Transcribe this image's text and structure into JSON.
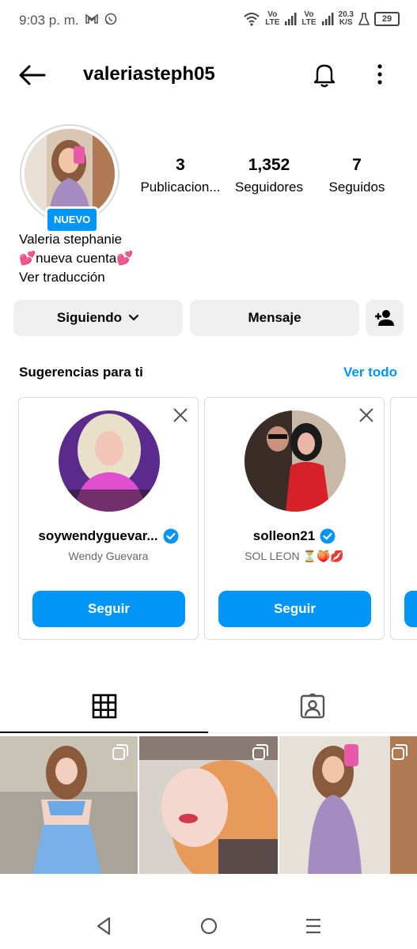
{
  "status_bar": {
    "time": "9:03 p. m.",
    "sig1_top": "Vo",
    "sig1_bottom": "LTE",
    "sig2_top": "Vo",
    "sig2_bottom": "LTE",
    "net_speed": "20.3",
    "net_unit": "K/S",
    "battery": "29"
  },
  "header": {
    "username": "valeriasteph05",
    "icons": [
      "back-arrow-icon",
      "bell-icon",
      "more-vertical-icon"
    ]
  },
  "profile": {
    "badge": "NUEVO",
    "stats": [
      {
        "value": "3",
        "label": "Publicacion..."
      },
      {
        "value": "1,352",
        "label": "Seguidores"
      },
      {
        "value": "7",
        "label": "Seguidos"
      }
    ],
    "name": "Valeria stephanie",
    "bio": "💕nueva cuenta💕",
    "translate": "Ver traducción"
  },
  "actions": {
    "following": "Siguiendo",
    "message": "Mensaje"
  },
  "suggestions": {
    "heading": "Sugerencias para ti",
    "see_all": "Ver todo",
    "cards": [
      {
        "username": "soywendyguevar...",
        "subtitle": "Wendy Guevara",
        "button": "Seguir"
      },
      {
        "username": "solleon21",
        "subtitle": "SOL LEON ⏳🍑💋",
        "button": "Seguir"
      }
    ]
  },
  "colors": {
    "accent": "#0095f6",
    "button_gray": "#efefef"
  }
}
